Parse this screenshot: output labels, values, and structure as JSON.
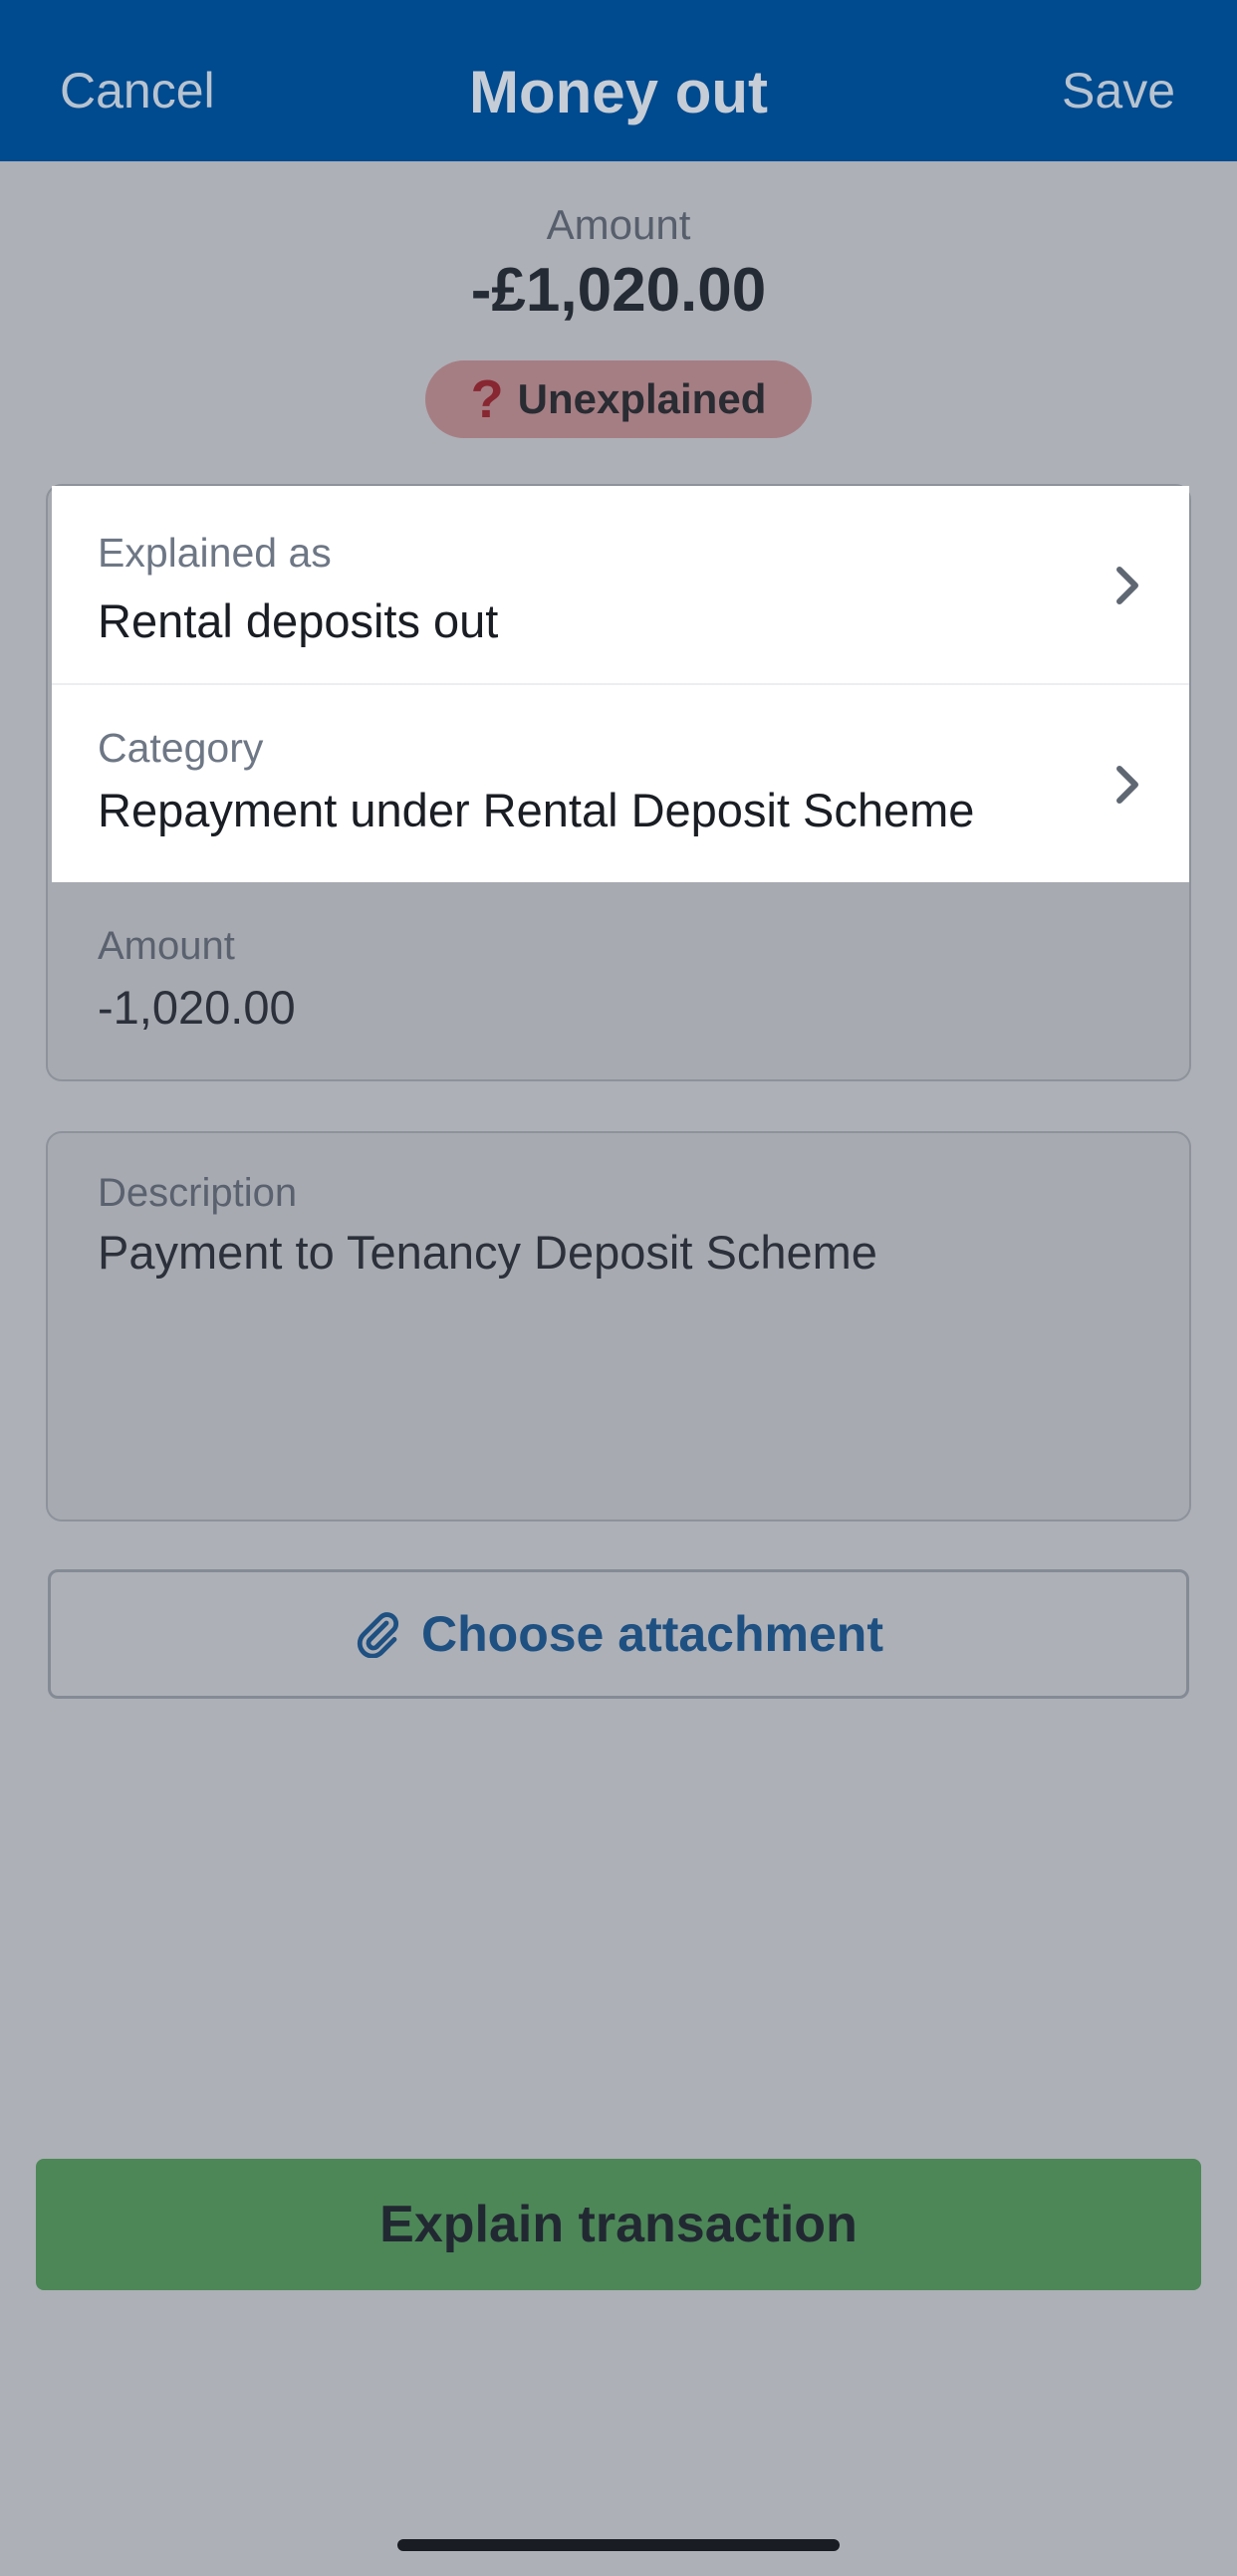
{
  "header": {
    "cancel_label": "Cancel",
    "title": "Money out",
    "save_label": "Save"
  },
  "summary": {
    "amount_label": "Amount",
    "amount_value": "-£1,020.00",
    "status_icon": "question-mark-icon",
    "status_text": "Unexplained"
  },
  "form": {
    "explained_as": {
      "label": "Explained as",
      "value": "Rental deposits out"
    },
    "category": {
      "label": "Category",
      "value": "Repayment under Rental Deposit Scheme"
    },
    "amount": {
      "label": "Amount",
      "value": "-1,020.00"
    },
    "description": {
      "label": "Description",
      "value": "Payment to Tenancy Deposit Scheme"
    }
  },
  "attachment": {
    "icon": "paperclip-icon",
    "label": "Choose attachment"
  },
  "footer": {
    "explain_label": "Explain transaction"
  },
  "colors": {
    "header_bg": "#004a8f",
    "status_pill": "#f2a9aa",
    "explain_button": "#5bb85d",
    "link_blue": "#0a5aa6"
  }
}
